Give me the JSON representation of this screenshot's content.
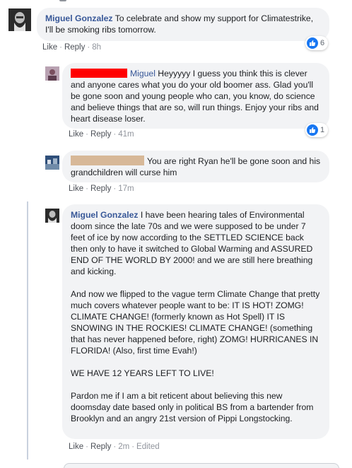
{
  "comments": [
    {
      "author": "Miguel Gonzalez",
      "text": "To celebrate and show my support for Climatestrike, I'll be smoking ribs tomorrow.",
      "actions": {
        "like": "Like",
        "reply": "Reply",
        "time": "8h"
      },
      "reactions": "6"
    },
    {
      "author": "Miguel",
      "text": "Heyyyyy I guess you think this is clever and anyone cares what you do your old boomer ass. Glad you'll be gone soon and young people who can, you know, do science and believe things that are so, will run things. Enjoy your ribs and heart disease loser.",
      "actions": {
        "like": "Like",
        "reply": "Reply",
        "time": "41m"
      },
      "reactions": "1"
    },
    {
      "text": "You are right Ryan he'll be gone soon and his grandchildren will curse him",
      "actions": {
        "like": "Like",
        "reply": "Reply",
        "time": "17m"
      }
    },
    {
      "author": "Miguel Gonzalez",
      "paragraphs": [
        "I have been hearing tales of Environmental doom since the late 70s and we were supposed to be under 7 feet of ice by now according to the SETTLED SCIENCE back then only to have it switched to Global Warming and ASSURED END OF THE WORLD BY 2000! and we are still here breathing and kicking.",
        "And now we flipped to the vague term Climate Change that pretty much covers whatever people want to be: IT IS HOT! ZOMG! CLIMATE CHANGE! (formerly known as Hot Spell) IT IS SNOWING IN THE ROCKIES! CLIMATE CHANGE! (something that has never happened before, right) ZOMG! HURRICANES IN FLORIDA! (Also, first time Evah!)",
        "WE HAVE 12 YEARS LEFT TO LIVE!",
        "Pardon me if I am a bit reticent about believing this new doomsday date based only in political BS from a bartender from Brooklyn and an angry 21st version of Pippi Longstocking."
      ],
      "actions": {
        "like": "Like",
        "reply": "Reply",
        "time": "2m",
        "edited": "Edited"
      }
    }
  ],
  "colors": {
    "author": "#385898",
    "bubble": "#f2f3f5",
    "like_badge": "#1877f2",
    "redaction_red": "#ff0000",
    "redaction_tan": "#d7b898"
  },
  "icons": {
    "reaction": "thumbs-up-icon"
  }
}
